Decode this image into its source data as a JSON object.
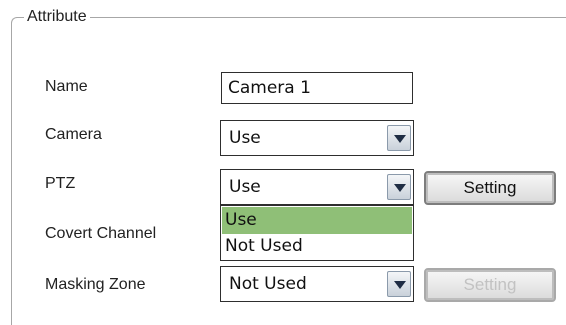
{
  "attribute_panel": {
    "legend": "Attribute",
    "name": {
      "label": "Name",
      "value": "Camera 1"
    },
    "camera": {
      "label": "Camera",
      "selected": "Use"
    },
    "ptz": {
      "label": "PTZ",
      "selected": "Use",
      "setting_label": "Setting",
      "dropdown_open": true,
      "options": [
        "Use",
        "Not Used"
      ],
      "highlighted_option": "Use"
    },
    "covert_channel": {
      "label": "Covert Channel"
    },
    "masking_zone": {
      "label": "Masking Zone",
      "selected": "Not Used",
      "setting_label": "Setting",
      "setting_enabled": false
    }
  },
  "colors": {
    "highlight": "#8fbf77",
    "border": "#2e2e2e",
    "group_line": "#a7a7a7",
    "disabled_text": "#c2c2c2"
  },
  "icons": {
    "select_arrow": "chevron-down-icon"
  }
}
